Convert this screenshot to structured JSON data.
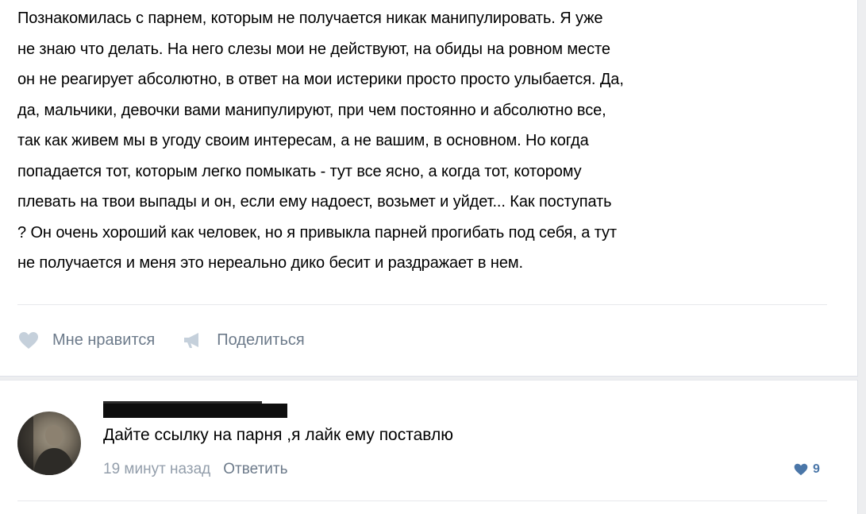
{
  "post": {
    "text": "Познакомилась с парнем, которым не получается никак манипулировать. Я уже\nне знаю что делать. На него слезы мои не действуют, на обиды на ровном месте\nон не реагирует абсолютно, в ответ на мои истерики просто просто улыбается. Да,\nда, мальчики, девочки вами манипулируют, при чем постоянно и абсолютно все,\nтак как живем мы в угоду своим интересам, а не вашим, в основном. Но когда\nпопадается тот, которым легко помыкать - тут все ясно, а когда тот, которому\nплевать на твои выпады и он, если ему надоест, возьмет и уйдет... Как поступать\n? Он очень хороший как человек, но я привыкла парней прогибать под себя, а тут\nне получается и меня это нереально дико бесит и раздражает в нем.",
    "like_label": "Мне нравится",
    "share_label": "Поделиться",
    "like_icon": "heart-icon",
    "share_icon": "megaphone-icon"
  },
  "comment": {
    "author_redacted": "",
    "text": "Дайте ссылку на парня ,я лайк ему поставлю",
    "time": "19 минут назад",
    "reply_label": "Ответить",
    "likes": "9",
    "like_icon": "heart-icon"
  },
  "colors": {
    "background": "#edeef0",
    "muted_text": "#6c7a8a",
    "icon_gray": "#c5d0db",
    "like_blue": "#4a76a8"
  }
}
